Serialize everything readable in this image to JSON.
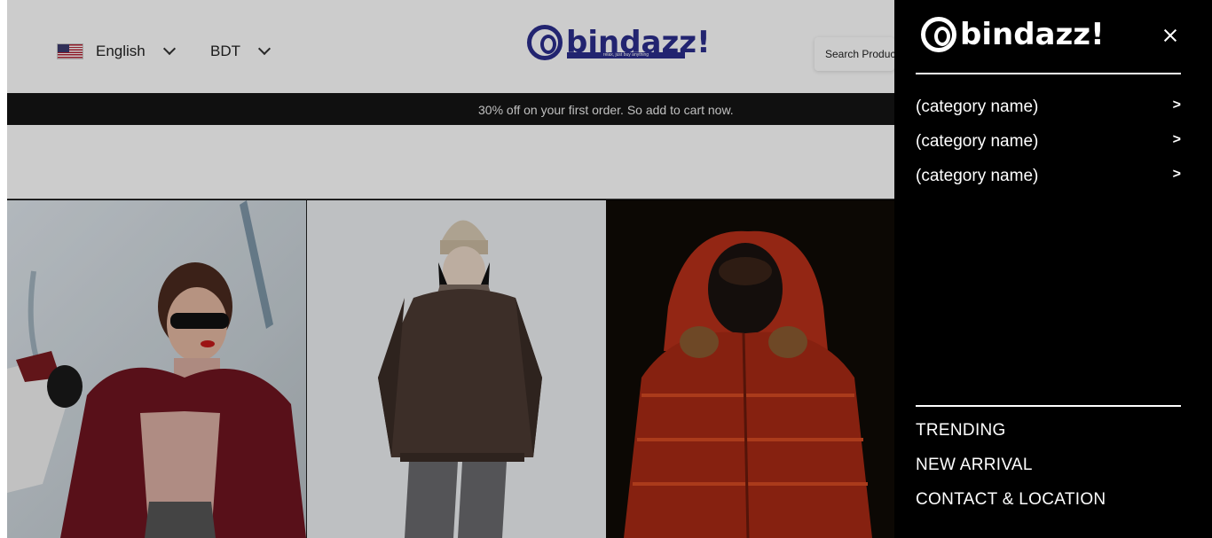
{
  "header": {
    "language": "English",
    "currency": "BDT",
    "brand": "bindazz",
    "brand_mark": "!",
    "tagline": "relax, just buy anything",
    "search_placeholder": "Search Products"
  },
  "promo": {
    "text": "30% off on your first order. So add to cart now."
  },
  "drawer": {
    "brand": "bindazz",
    "brand_mark": "!",
    "categories": [
      {
        "label": "(category name)",
        "arrow": ">"
      },
      {
        "label": "(category name)",
        "arrow": ">"
      },
      {
        "label": "(category name)",
        "arrow": ">"
      }
    ],
    "links": [
      "TRENDING",
      "NEW ARRIVAL",
      "CONTACT & LOCATION"
    ]
  },
  "colors": {
    "brand": "#2b2d8c",
    "drawer_bg": "#000000",
    "promo_bg": "#151515"
  },
  "icons": [
    "us-flag-icon",
    "chevron-down-icon",
    "close-icon",
    "brand-logo-icon"
  ]
}
